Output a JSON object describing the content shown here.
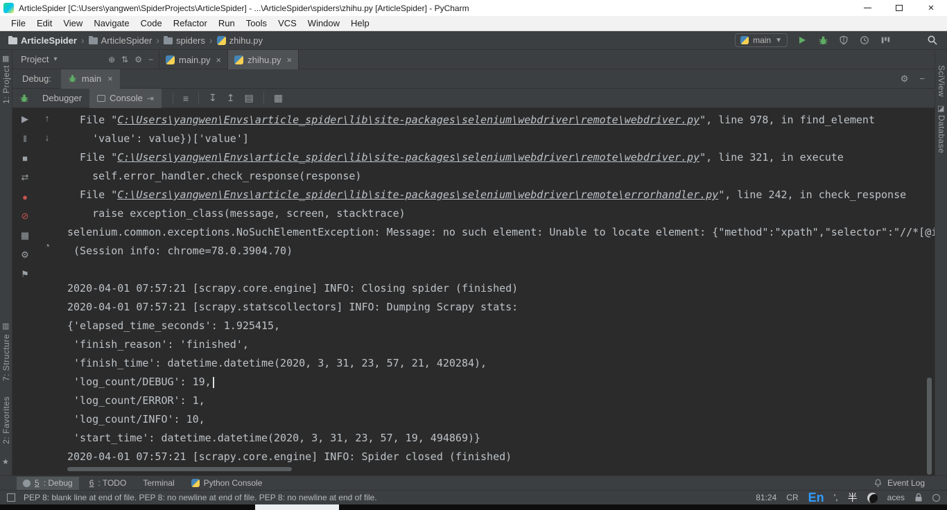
{
  "colors": {
    "panel": "#3c3f41",
    "console_bg": "#2b2b2b",
    "active_tab": "#4e5254",
    "run_green": "#5fad65",
    "error_red": "#c75450",
    "ime_blue": "#2f9bff",
    "console_text": "#bec3c8"
  },
  "window": {
    "title": "ArticleSpider [C:\\Users\\yangwen\\SpiderProjects\\ArticleSpider] - ...\\ArticleSpider\\spiders\\zhihu.py [ArticleSpider] - PyCharm"
  },
  "menu": {
    "items": [
      "File",
      "Edit",
      "View",
      "Navigate",
      "Code",
      "Refactor",
      "Run",
      "Tools",
      "VCS",
      "Window",
      "Help"
    ]
  },
  "navbar": {
    "separator": "›",
    "breadcrumbs": [
      {
        "label": "ArticleSpider",
        "icon": "project-folder-icon",
        "bold": true
      },
      {
        "label": "ArticleSpider",
        "icon": "folder-icon"
      },
      {
        "label": "spiders",
        "icon": "folder-icon"
      },
      {
        "label": "zhihu.py",
        "icon": "python-file-icon"
      }
    ],
    "run_config_label": "main"
  },
  "project_panel": {
    "title": "Project",
    "chevron": "▾",
    "icons": [
      {
        "name": "locate-file-icon",
        "glyph": "⊕"
      },
      {
        "name": "collapse-all-icon",
        "glyph": "⇅"
      },
      {
        "name": "settings-gear-icon",
        "glyph": "⚙"
      },
      {
        "name": "hide-panel-icon",
        "glyph": "−"
      }
    ]
  },
  "editor_tabs": [
    {
      "label": "main.py",
      "active": false
    },
    {
      "label": "zhihu.py",
      "active": true
    }
  ],
  "debug_panel": {
    "label": "Debug:",
    "session_tab_label": "main",
    "view_tabs": [
      {
        "label": "Debugger",
        "active": false
      },
      {
        "label": "Console",
        "active": true
      }
    ],
    "jump_glyph": "⇥",
    "header_icons": [
      {
        "name": "settings-gear-icon",
        "glyph": "⚙"
      },
      {
        "name": "hide-panel-icon",
        "glyph": "−"
      }
    ]
  },
  "console_toolbar_icons": [
    {
      "sep": true
    },
    {
      "name": "soft-wrap-icon",
      "glyph": "≡"
    },
    {
      "sep": true
    },
    {
      "name": "scroll-to-end-icon",
      "glyph": "↧"
    },
    {
      "name": "scroll-to-top-icon",
      "glyph": "↥"
    },
    {
      "name": "print-icon",
      "glyph": "▤"
    },
    {
      "sep": true
    },
    {
      "name": "clear-all-icon",
      "glyph": "▦"
    }
  ],
  "debug_gutter": {
    "col1": [
      {
        "name": "resume-icon",
        "glyph": "▶"
      },
      {
        "name": "pause-icon",
        "glyph": "‖"
      },
      {
        "name": "stop-icon",
        "glyph": "■"
      },
      {
        "name": "restore-layout-icon",
        "glyph": "⇄"
      },
      {
        "name": "breakpoints-icon",
        "glyph": "●",
        "color": "#c75450"
      },
      {
        "name": "mute-breakpoints-icon",
        "glyph": "⊘",
        "color": "#c75450"
      },
      {
        "name": "layout-windows-icon",
        "glyph": "▦"
      },
      {
        "name": "settings-gear-icon",
        "glyph": "⚙"
      },
      {
        "name": "pin-icon",
        "glyph": "⚑"
      }
    ],
    "col2": [
      {
        "name": "up-stack-icon",
        "glyph": "↑"
      },
      {
        "name": "down-stack-icon",
        "glyph": "↓"
      },
      {
        "name": "history-icon",
        "glyph": "◔",
        "gap": true
      }
    ]
  },
  "console": {
    "cursor_line": 14,
    "lines": [
      {
        "segments": [
          {
            "t": "  File \"",
            "c": "p"
          },
          {
            "t": "C:\\Users\\yangwen\\Envs\\article_spider\\lib\\site-packages\\selenium\\webdriver\\remote\\webdriver.py",
            "c": "link"
          },
          {
            "t": "\", line 978, in find_element",
            "c": "p"
          }
        ]
      },
      {
        "segments": [
          {
            "t": "    'value': value})['value']",
            "c": "p"
          }
        ]
      },
      {
        "segments": [
          {
            "t": "  File \"",
            "c": "p"
          },
          {
            "t": "C:\\Users\\yangwen\\Envs\\article_spider\\lib\\site-packages\\selenium\\webdriver\\remote\\webdriver.py",
            "c": "link"
          },
          {
            "t": "\", line 321, in execute",
            "c": "p"
          }
        ]
      },
      {
        "segments": [
          {
            "t": "    self.error_handler.check_response(response)",
            "c": "p"
          }
        ]
      },
      {
        "segments": [
          {
            "t": "  File \"",
            "c": "p"
          },
          {
            "t": "C:\\Users\\yangwen\\Envs\\article_spider\\lib\\site-packages\\selenium\\webdriver\\remote\\errorhandler.py",
            "c": "link"
          },
          {
            "t": "\", line 242, in check_response",
            "c": "p"
          }
        ]
      },
      {
        "segments": [
          {
            "t": "    raise exception_class(message, screen, stacktrace)",
            "c": "p"
          }
        ]
      },
      {
        "segments": [
          {
            "t": "selenium.common.exceptions.NoSuchElementException: Message: no such element: Unable to locate element: {\"method\":\"xpath\",\"selector\":\"//*[@i",
            "c": "p"
          }
        ]
      },
      {
        "segments": [
          {
            "t": " (Session info: chrome=78.0.3904.70)",
            "c": "p"
          }
        ]
      },
      {
        "segments": []
      },
      {
        "segments": [
          {
            "t": "2020-04-01 07:57:21 [scrapy.core.engine] INFO: Closing spider (finished)",
            "c": "p"
          }
        ]
      },
      {
        "segments": [
          {
            "t": "2020-04-01 07:57:21 [scrapy.statscollectors] INFO: Dumping Scrapy stats:",
            "c": "p"
          }
        ]
      },
      {
        "segments": [
          {
            "t": "{'elapsed_time_seconds': 1.925415,",
            "c": "p"
          }
        ]
      },
      {
        "segments": [
          {
            "t": " 'finish_reason': 'finished',",
            "c": "p"
          }
        ]
      },
      {
        "segments": [
          {
            "t": " 'finish_time': datetime.datetime(2020, 3, 31, 23, 57, 21, 420284),",
            "c": "p"
          }
        ]
      },
      {
        "segments": [
          {
            "t": " 'log_count/DEBUG': 19,",
            "c": "p"
          }
        ]
      },
      {
        "segments": [
          {
            "t": " 'log_count/ERROR': 1,",
            "c": "p"
          }
        ]
      },
      {
        "segments": [
          {
            "t": " 'log_count/INFO': 10,",
            "c": "p"
          }
        ]
      },
      {
        "segments": [
          {
            "t": " 'start_time': datetime.datetime(2020, 3, 31, 23, 57, 19, 494869)}",
            "c": "p"
          }
        ]
      },
      {
        "segments": [
          {
            "t": "2020-04-01 07:57:21 [scrapy.core.engine] INFO: Spider closed (finished)",
            "c": "p"
          }
        ]
      }
    ]
  },
  "tool_strips": {
    "left": [
      {
        "label": "1: Project"
      },
      {
        "label": "7: Structure"
      },
      {
        "label": "2: Favorites"
      }
    ],
    "right": [
      {
        "label": "SciView"
      },
      {
        "label": "Database"
      }
    ]
  },
  "bottom_bar": {
    "tabs": [
      {
        "num": "5",
        "label": "Debug",
        "icon": "debug-tool-icon",
        "active": true
      },
      {
        "num": "6",
        "label": "TODO"
      },
      {
        "label": "Terminal"
      },
      {
        "label": "Python Console",
        "icon": "python-console-icon"
      }
    ],
    "event_log_label": "Event Log"
  },
  "status_bar": {
    "message": "PEP 8: blank line at end of file. PEP 8: no newline at end of file. PEP 8: no newline at end of file.",
    "caret_position": "81:24",
    "line_separator": "CR",
    "ime_lang": "En",
    "ime_punct": "’,",
    "ime_width": "半",
    "indent_fragment": "aces"
  }
}
